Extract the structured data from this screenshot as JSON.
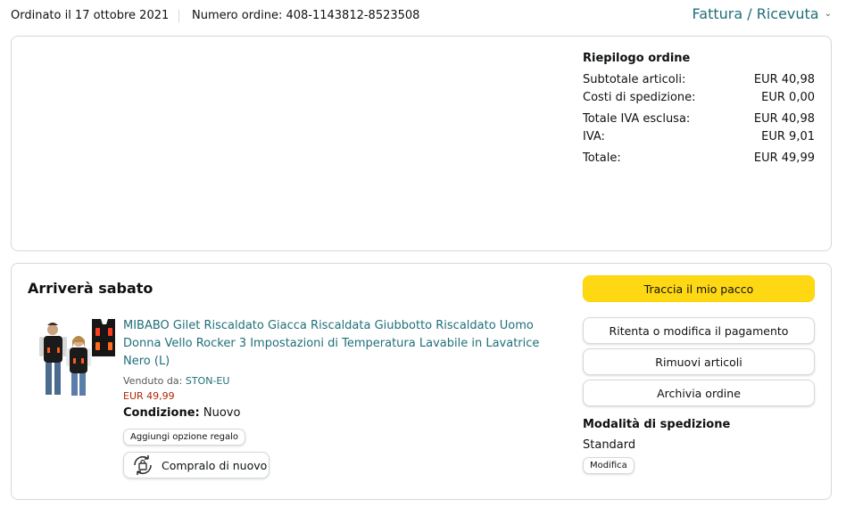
{
  "header": {
    "order_date": "Ordinato il 17 ottobre 2021",
    "order_number": "Numero ordine: 408-1143812-8523508",
    "invoice_link": "Fattura / Ricevuta"
  },
  "summary": {
    "title": "Riepilogo ordine",
    "rows": [
      {
        "label": "Subtotale articoli:",
        "value": "EUR 40,98"
      },
      {
        "label": "Costi di spedizione:",
        "value": "EUR 0,00"
      },
      {
        "label": "Totale IVA esclusa:",
        "value": "EUR 40,98"
      },
      {
        "label": "IVA:",
        "value": "EUR 9,01"
      },
      {
        "label": "Totale:",
        "value": "EUR 49,99"
      }
    ]
  },
  "shipment": {
    "status": "Arriverà sabato",
    "product": {
      "title": "MIBABO Gilet Riscaldato Giacca Riscaldata Giubbotto Riscaldato Uomo Donna Vello Rocker 3 Impostazioni di Temperatura Lavabile in Lavatrice Nero (L)",
      "sold_by_label": "Venduto da:",
      "seller": "STON-EU",
      "price": "EUR 49,99",
      "condition_label": "Condizione:",
      "condition_value": "Nuovo",
      "gift_button": "Aggiungi opzione regalo",
      "buy_again_button": "Compralo di nuovo"
    },
    "actions": {
      "track": "Traccia il mio pacco",
      "retry_payment": "Ritenta o modifica il pagamento",
      "remove_items": "Rimuovi articoli",
      "archive": "Archivia ordine"
    },
    "shipping_method": {
      "title": "Modalità di spedizione",
      "value": "Standard",
      "edit": "Modifica"
    }
  },
  "colors": {
    "link": "#1f6f7a",
    "price": "#b12704",
    "primary_button": "#ffd814",
    "border": "#d5d9d9"
  }
}
